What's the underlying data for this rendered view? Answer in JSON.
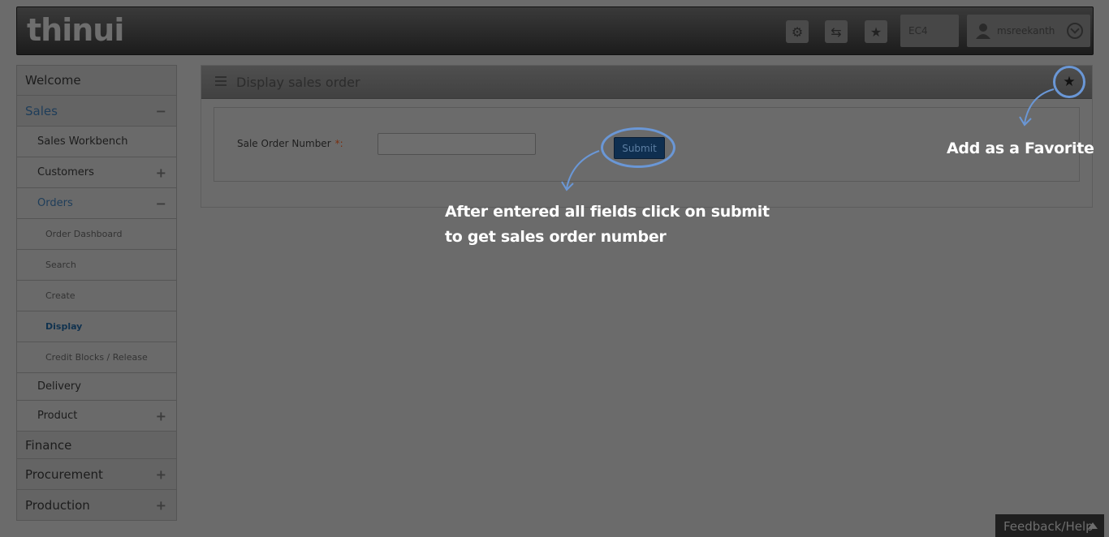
{
  "header": {
    "logo": "thinui",
    "client": "EC4",
    "user": "msreekanth",
    "icons": [
      "gear-icon",
      "transaction-icon",
      "star-icon",
      "user-icon",
      "chevron-down-icon"
    ]
  },
  "sidebar": {
    "items": [
      {
        "label": "Welcome",
        "toggle": ""
      },
      {
        "label": "Sales",
        "toggle": "−"
      },
      {
        "label": "Sales Workbench",
        "toggle": ""
      },
      {
        "label": "Customers",
        "toggle": "+"
      },
      {
        "label": "Orders",
        "toggle": "−"
      },
      {
        "label": "Order Dashboard",
        "toggle": ""
      },
      {
        "label": "Search",
        "toggle": ""
      },
      {
        "label": "Create",
        "toggle": ""
      },
      {
        "label": "Display",
        "toggle": ""
      },
      {
        "label": "Credit Blocks / Release",
        "toggle": ""
      },
      {
        "label": "Delivery",
        "toggle": ""
      },
      {
        "label": "Product",
        "toggle": "+"
      },
      {
        "label": "Finance",
        "toggle": ""
      },
      {
        "label": "Procurement",
        "toggle": "+"
      },
      {
        "label": "Production",
        "toggle": "+"
      }
    ]
  },
  "panel": {
    "title": "Display sales order",
    "field_label": "Sale Order Number",
    "required_mark": "*:",
    "submit_label": "Submit"
  },
  "annotations": {
    "favorite": "Add as a Favorite",
    "submit_line1": "After entered all fields click on submit",
    "submit_line2": "to get sales order number"
  },
  "feedback": "Feedback/Help"
}
